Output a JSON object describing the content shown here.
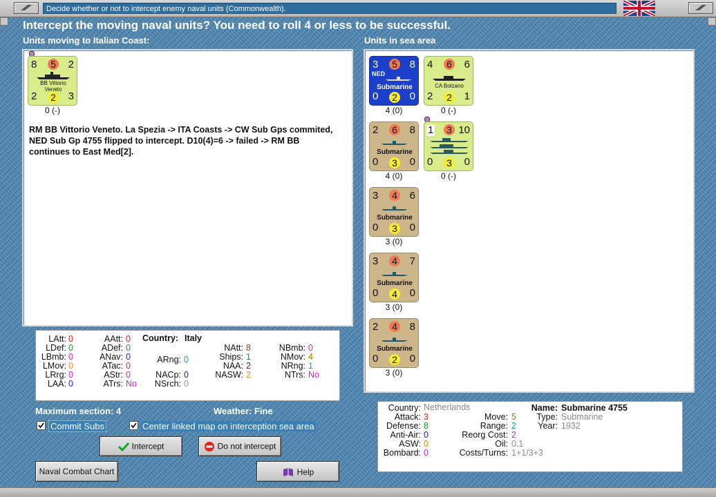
{
  "window": {
    "title": "Decide whether or not to intercept enemy naval units (Commonwealth)."
  },
  "heading": "Intercept the moving naval units?  You need to roll 4 or less to be successful.",
  "moving": {
    "section_title": "Units moving to Italian Coast:",
    "units": [
      {
        "tl": "8",
        "top": "5",
        "tr": "2",
        "bl": "2",
        "bottom": "2",
        "br": "3",
        "label_line1": "BB Vittorio",
        "label_line2": "Veneto",
        "caption": "0 (-)",
        "color": "green"
      }
    ],
    "log_text": "RM BB Vittorio Veneto.  La Spezia -> ITA Coasts -> CW Sub Gps commited, NED Sub Gp 4755 flipped to intercept.  D10(4)=6 -> failed -> RM BB continues to East Med[2]."
  },
  "sea_area": {
    "section_title": "Units in sea area",
    "units": [
      {
        "tl": "3",
        "top": "5",
        "tr": "8",
        "bl": "0",
        "bottom": "2",
        "br": "0",
        "nation": "NED",
        "label": "Submarine",
        "caption": "4 (0)",
        "color": "blue"
      },
      {
        "tl": "4",
        "top": "6",
        "tr": "6",
        "bl": "2",
        "bottom": "2",
        "br": "1",
        "label": "CA Bolzano",
        "caption": "0 (-)",
        "color": "green"
      },
      {
        "tl": "2",
        "top": "6",
        "tr": "8",
        "bl": "0",
        "bottom": "3",
        "br": "0",
        "label": "Submarine",
        "caption": "4 (0)",
        "color": "tan"
      },
      {
        "tl": "1",
        "top": "3",
        "tr": "10",
        "bl": "0",
        "bottom": "3",
        "br": "0",
        "label": "",
        "caption": "0 (-)",
        "color": "green"
      },
      {
        "tl": "3",
        "top": "4",
        "tr": "6",
        "bl": "0",
        "bottom": "3",
        "br": "0",
        "label": "Submarine",
        "caption": "3 (0)",
        "color": "tan"
      },
      {
        "tl": "3",
        "top": "4",
        "tr": "7",
        "bl": "0",
        "bottom": "4",
        "br": "0",
        "label": "Submarine",
        "caption": "3 (0)",
        "color": "tan"
      },
      {
        "tl": "2",
        "top": "4",
        "tr": "8",
        "bl": "0",
        "bottom": "2",
        "br": "0",
        "label": "Submarine",
        "caption": "3 (0)",
        "color": "tan"
      }
    ]
  },
  "country_stats": {
    "country_label": "Country:",
    "country_value": "Italy",
    "items": {
      "latt": {
        "label": "LAtt:",
        "value": "0"
      },
      "ldef": {
        "label": "LDef:",
        "value": "0"
      },
      "lbmb": {
        "label": "LBmb:",
        "value": "0"
      },
      "lmov": {
        "label": "LMov:",
        "value": "0"
      },
      "lrng": {
        "label": "LRrg:",
        "value": "0"
      },
      "laa": {
        "label": "LAA:",
        "value": "0"
      },
      "aatt": {
        "label": "AAtt:",
        "value": "0"
      },
      "adef": {
        "label": "ADef:",
        "value": "0"
      },
      "anav": {
        "label": "ANav:",
        "value": "0"
      },
      "atac": {
        "label": "ATac:",
        "value": "0"
      },
      "astr": {
        "label": "AStr:",
        "value": "0"
      },
      "atrs": {
        "label": "ATrs:",
        "value": "No"
      },
      "arng": {
        "label": "ARng:",
        "value": "0"
      },
      "nacp": {
        "label": "NACp:",
        "value": "0"
      },
      "nsrch": {
        "label": "NSrch:",
        "value": "0"
      },
      "natt": {
        "label": "NAtt:",
        "value": "8"
      },
      "ships": {
        "label": "Ships:",
        "value": "1"
      },
      "naa": {
        "label": "NAA:",
        "value": "2"
      },
      "nasw": {
        "label": "NASW:",
        "value": "2"
      },
      "nbmb": {
        "label": "NBmb:",
        "value": "0"
      },
      "nmov": {
        "label": "NMov:",
        "value": "4"
      },
      "nrng": {
        "label": "NRng:",
        "value": "1"
      },
      "ntrs": {
        "label": "NTrs:",
        "value": "No"
      }
    }
  },
  "info": {
    "max_section_label": "Maximum section: 4",
    "weather_label": "Weather:  Fine"
  },
  "options": {
    "commit_subs": {
      "label": "Commit Subs",
      "checked": true
    },
    "center_map": {
      "label": "Center linked map on interception sea area",
      "checked": true
    }
  },
  "buttons": {
    "intercept": "Intercept",
    "do_not_intercept": "Do not intercept",
    "naval_combat_chart": "Naval Combat Chart",
    "help": "Help"
  },
  "unit_stats": {
    "items": {
      "country": {
        "label": "Country:",
        "value": "Netherlands"
      },
      "attack": {
        "label": "Attack:",
        "value": "3"
      },
      "defense": {
        "label": "Defense:",
        "value": "8"
      },
      "antiair": {
        "label": "Anti-Air:",
        "value": "0"
      },
      "asw": {
        "label": "ASW:",
        "value": "0"
      },
      "bombard": {
        "label": "Bombard:",
        "value": "0"
      },
      "move": {
        "label": "Move:",
        "value": "5"
      },
      "range": {
        "label": "Range:",
        "value": "2"
      },
      "reorg": {
        "label": "Reorg Cost:",
        "value": "2"
      },
      "oil": {
        "label": "Oil:",
        "value": "0.1"
      },
      "costs": {
        "label": "Costs/Turns:",
        "value": "1+1/3+3"
      },
      "name": {
        "label": "Name:",
        "value": "Submarine 4755"
      },
      "type": {
        "label": "Type:",
        "value": "Submarine"
      },
      "year": {
        "label": "Year:",
        "value": "1932"
      }
    }
  },
  "colors": {
    "counter_tan": "#cdb68a",
    "counter_green": "#d9ec8a",
    "counter_blue": "#1b3fc9",
    "strength_red": "#f07a50",
    "strength_yellow": "#f6ee2a"
  }
}
